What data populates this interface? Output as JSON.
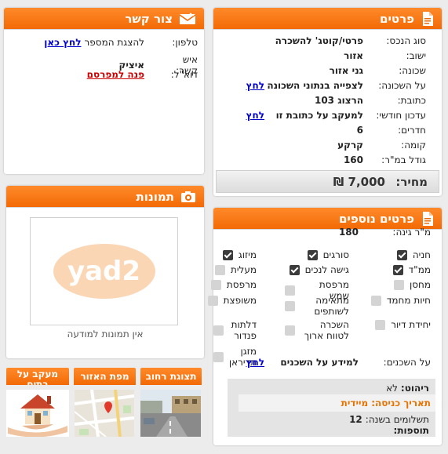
{
  "details": {
    "title": "פרטים",
    "rows": [
      {
        "label": "סוג הנכס:",
        "value": "פרטי/קוטג' להשכרה"
      },
      {
        "label": "ישוב:",
        "value": "אזור"
      },
      {
        "label": "שכונה:",
        "value": "גני אזור"
      },
      {
        "label": "על השכונה:",
        "value": "לצפייה בנתוני השכונה",
        "link": "לחץ"
      },
      {
        "label": "כתובת:",
        "value": "הרצוג 103"
      },
      {
        "label": "עדכון חודשי:",
        "value": "למעקב על כתובת זו",
        "link": "לחץ"
      },
      {
        "label": "חדרים:",
        "value": "6"
      },
      {
        "label": "קומה:",
        "value": "קרקע"
      },
      {
        "label": "גודל במ\"ר:",
        "value": "160"
      }
    ],
    "price_label": "מחיר:",
    "price_value": "7,000 ₪"
  },
  "contact": {
    "title": "צור קשר",
    "phone_label": "טלפון:",
    "phone_text": "להצגת המספר",
    "phone_link": "לחץ כאן",
    "person_label": "איש קשר:",
    "person_value": "איציק",
    "email_label": "דוא\"ל:",
    "email_link": "פנה למפרסם"
  },
  "photos": {
    "title": "תמונות",
    "logo_text": "yad2",
    "caption": "אין תמונות למודעה"
  },
  "thumbs": {
    "street": "תצוגת רחוב",
    "map": "מפת האזור",
    "track": "מעקב על בתים"
  },
  "extra": {
    "title": "פרטים נוספים",
    "garden_label": "מ\"ר גינה:",
    "garden_value": "180",
    "features": [
      {
        "label": "מיזוג",
        "checked": true
      },
      {
        "label": "סורגים",
        "checked": true
      },
      {
        "label": "חניה",
        "checked": true
      },
      {
        "label": "מעלית",
        "checked": false
      },
      {
        "label": "גישה לנכים",
        "checked": true
      },
      {
        "label": "ממ\"ד",
        "checked": true
      },
      {
        "label": "מרפסת",
        "checked": false
      },
      {
        "label": "מרפסת שמש",
        "checked": false
      },
      {
        "label": "מחסן",
        "checked": false
      },
      {
        "label": "משופצת",
        "checked": false
      },
      {
        "label": "מתאימה לשותפים",
        "checked": false
      },
      {
        "label": "חיות מחמד",
        "checked": false
      },
      {
        "label": "דלתות פנדור",
        "checked": false
      },
      {
        "label": "השכרה לטווח ארוך",
        "checked": false
      },
      {
        "label": "יחידת דיור",
        "checked": false
      },
      {
        "label": "מזגן תדיראן",
        "checked": false
      }
    ],
    "neighbors_label": "על השכנים:",
    "neighbors_text": "למידע על השכנים",
    "neighbors_link": "לחץ",
    "furniture_label": "ריהוט:",
    "furniture_value": "לא",
    "entry_label": "תאריך כניסה:",
    "entry_value": "מיידית",
    "payments_label": "תשלומים בשנה:",
    "payments_value": "12",
    "additions_label": "תוספות:"
  }
}
